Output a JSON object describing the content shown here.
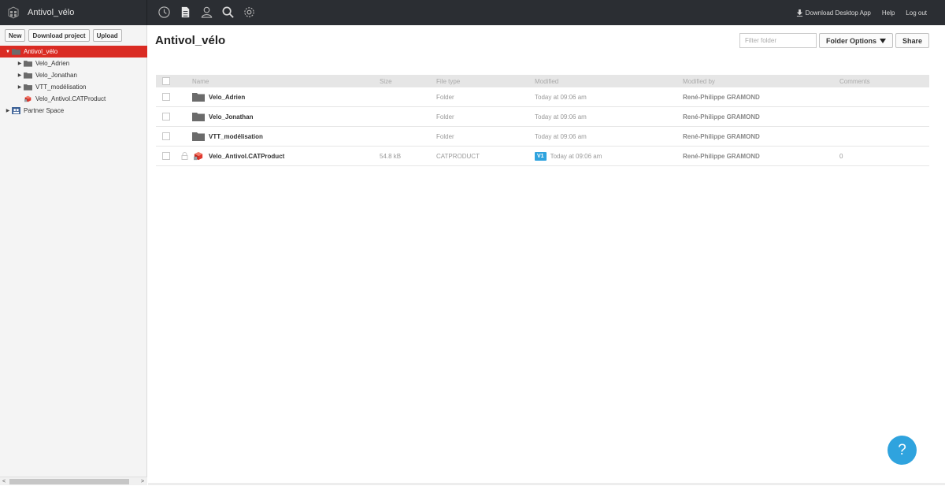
{
  "brand": {
    "title": "Antivol_vélo",
    "icon": "cube-grid-icon"
  },
  "nav": [
    {
      "name": "history-icon"
    },
    {
      "name": "document-icon"
    },
    {
      "name": "user-icon"
    },
    {
      "name": "search-icon"
    },
    {
      "name": "gear-icon"
    }
  ],
  "topbar_links": {
    "download_app": "Download Desktop App",
    "help": "Help",
    "logout": "Log out"
  },
  "sidebar": {
    "new_label": "New",
    "download_label": "Download project",
    "upload_label": "Upload",
    "tree": [
      {
        "label": "Antivol_vélo",
        "level": 0,
        "arrow": "▼",
        "icon": "folder-icon",
        "selected": true
      },
      {
        "label": "Velo_Adrien",
        "level": 1,
        "arrow": "▶",
        "icon": "folder-icon"
      },
      {
        "label": "Velo_Jonathan",
        "level": 1,
        "arrow": "▶",
        "icon": "folder-icon"
      },
      {
        "label": "VTT_modélisation",
        "level": 1,
        "arrow": "▶",
        "icon": "folder-icon"
      },
      {
        "label": "Velo_Antivol.CATProduct",
        "level": 1,
        "arrow": "",
        "icon": "catproduct-icon"
      },
      {
        "label": "Partner Space",
        "level": 0,
        "arrow": "▶",
        "icon": "partner-space-icon"
      }
    ]
  },
  "main": {
    "title": "Antivol_vélo",
    "filter_placeholder": "Filter folder",
    "folder_options_label": "Folder Options",
    "share_label": "Share",
    "columns": {
      "name": "Name",
      "size": "Size",
      "type": "File type",
      "modified": "Modified",
      "modified_by": "Modified by",
      "comments": "Comments"
    },
    "rows": [
      {
        "name": "Velo_Adrien",
        "size": "",
        "type": "Folder",
        "version": "",
        "modified": "Today at 09:06 am",
        "modified_by": "René-Philippe GRAMOND",
        "comments": "",
        "icon": "folder-icon"
      },
      {
        "name": "Velo_Jonathan",
        "size": "",
        "type": "Folder",
        "version": "",
        "modified": "Today at 09:06 am",
        "modified_by": "René-Philippe GRAMOND",
        "comments": "",
        "icon": "folder-icon"
      },
      {
        "name": "VTT_modélisation",
        "size": "",
        "type": "Folder",
        "version": "",
        "modified": "Today at 09:06 am",
        "modified_by": "René-Philippe GRAMOND",
        "comments": "",
        "icon": "folder-icon"
      },
      {
        "name": "Velo_Antivol.CATProduct",
        "size": "54.8 kB",
        "type": "CATPRODUCT",
        "version": "V1",
        "modified": "Today at 09:06 am",
        "modified_by": "René-Philippe GRAMOND",
        "comments": "0",
        "icon": "catproduct-icon"
      }
    ],
    "help_label": "?"
  },
  "colors": {
    "topbar": "#2b2e33",
    "selected": "#da2b23",
    "accent": "#2fa3de"
  }
}
